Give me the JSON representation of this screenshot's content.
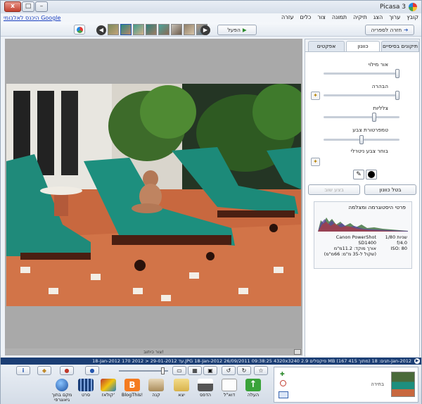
{
  "window": {
    "title": "Picasa 3",
    "buttons": {
      "close": "x",
      "maximize": "□",
      "minimize": "–"
    }
  },
  "menubar": {
    "items": [
      "קובץ",
      "ערוך",
      "הצג",
      "תיקיה",
      "תמונה",
      "צור",
      "כלים",
      "עזרה"
    ],
    "google_link": "היכנס לאלבומי Google"
  },
  "toolbar": {
    "back_to_library": "חזרה לספריה",
    "play": "הפעל",
    "nav_prev_icon": "chevron-left-icon",
    "nav_next_icon": "chevron-right-icon"
  },
  "editor_tabs": {
    "basic_fixes": "תיקונים בסיסיים",
    "tuning": "כוונון",
    "effects": "אפקטים"
  },
  "tuning": {
    "fill_light": "אור מילוי",
    "highlights": "הבהרה",
    "shadows": "צלליות",
    "color_temperature": "טמפרטורת צבע",
    "neutral_color_picker": "בוחר צבע ניטרלי",
    "undo_tuning": "בטל כוונון",
    "redo": "בצע שוב",
    "levels": {
      "fill_light": 1.0,
      "highlights": 1.0,
      "shadows": 0.68,
      "color_temperature": 0.5
    }
  },
  "histogram": {
    "title": "פרטי היסטוגרמה ומצלמה",
    "camera": "Canon PowerShot SD1400",
    "focal_length": "אורך מוקד: 11.2מ\"מ",
    "equivalent": "(שקול ל-35 מ\"מ: 66מ\"מ)",
    "shutter": "1/80 שניות",
    "aperture": "f/4.0",
    "iso": "ISO: 80"
  },
  "viewer": {
    "caption_placeholder": "צור כיתוב!"
  },
  "status": {
    "text": "18-Jan-2012 עד 29-01-2012 < 2012 170.JPG 18-Jan-2012   26/09/2011 09:38:25   4320x3240 פיקסלים   2.9 MB (167 מתוך 415)   תגים: 18-Jan-2012"
  },
  "tray": {
    "buttons": {
      "upload": "העלה",
      "email": "דוא\"ל",
      "print": "הדפס",
      "export": "יצא",
      "shop": "קנה",
      "blogthis": "BlogThis!",
      "collage": "קולאז'",
      "movie": "סרט",
      "geotag": "מקם בתוך גיאוגרפי"
    },
    "selection_label": "בחירה"
  },
  "colors": {
    "status_bg": "#1b3e74",
    "upload_green": "#3aa33a",
    "blogger_orange": "#f47b20"
  }
}
